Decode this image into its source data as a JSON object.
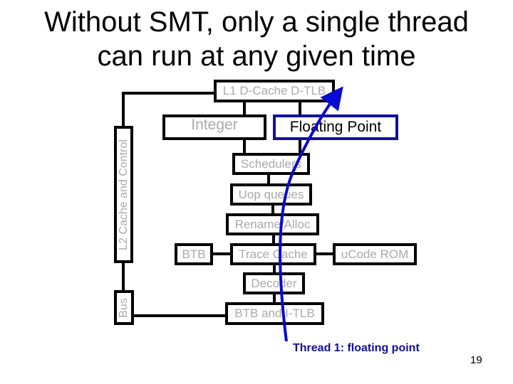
{
  "slide": {
    "title_line1": "Without SMT, only a single thread",
    "title_line2": "can run at any given time",
    "page_number": "19"
  },
  "units": {
    "l1_dcache": "L1 D-Cache D-TLB",
    "l2_cache": "L2 Cache and Control",
    "bus": "Bus",
    "integer": "Integer",
    "floating_point": "Floating Point",
    "schedulers": "Schedulers",
    "uop_queues": "Uop queues",
    "rename_alloc": "Rename/Alloc",
    "btb": "BTB",
    "trace_cache": "Trace Cache",
    "ucode_rom": "uCode ROM",
    "decoder": "Decoder",
    "btb_itlb": "BTB and I-TLB"
  },
  "thread": {
    "label": "Thread 1: floating point",
    "active_unit": "Floating Point",
    "color": "#0a0ad0"
  },
  "colors": {
    "inactive_text": "#aaaaaa",
    "active_border": "#1010a0",
    "caption": "#10109a"
  }
}
